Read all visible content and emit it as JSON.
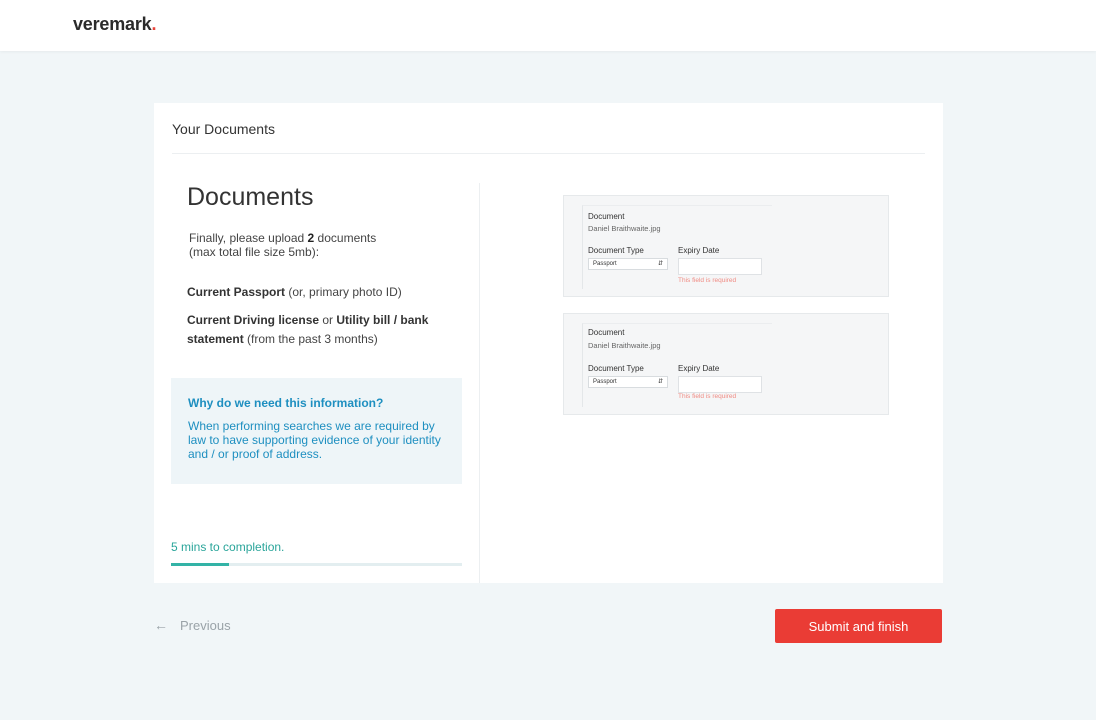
{
  "brand": {
    "name": "veremark",
    "dot": "."
  },
  "card": {
    "title": "Your Documents"
  },
  "left": {
    "heading": "Documents",
    "intro_prefix": "Finally, please upload ",
    "intro_count": "2",
    "intro_suffix": " documents",
    "intro_line2": "(max total file size 5mb):",
    "req1_bold": "Current Passport",
    "req1_rest": " (or, primary photo ID)",
    "req2_bold1": "Current Driving license",
    "req2_mid": " or ",
    "req2_bold2": "Utility bill / bank statement",
    "req2_rest": " (from the past 3 months)"
  },
  "info": {
    "title": "Why do we need this information?",
    "text": "When performing searches we are required by law to have supporting evidence of your identity and / or proof of address."
  },
  "progress": {
    "text": "5 mins to completion.",
    "fraction": 0.2
  },
  "documents": [
    {
      "label": "Document",
      "filename": "Daniel Braithwaite.jpg",
      "type_label": "Document Type",
      "type_value": "Passport",
      "expiry_label": "Expiry Date",
      "error": "This field is required"
    },
    {
      "label": "Document",
      "filename": "Daniel Braithwaite.jpg",
      "type_label": "Document Type",
      "type_value": "Passport",
      "expiry_label": "Expiry Date",
      "error": "This field is required"
    }
  ],
  "footer": {
    "previous": "Previous",
    "submit": "Submit and finish"
  },
  "colors": {
    "accent": "#ea3c35",
    "info": "#1e8fc0",
    "progress": "#33b3a6"
  }
}
